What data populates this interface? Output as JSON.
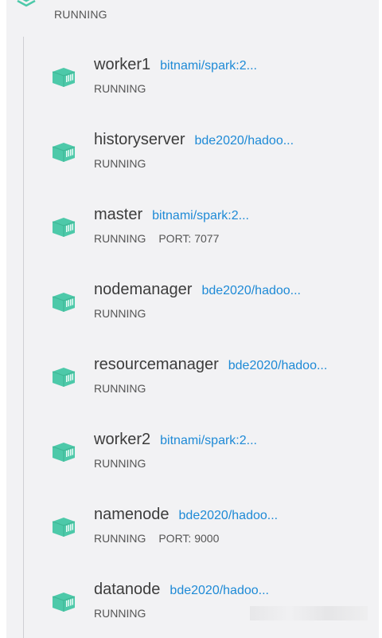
{
  "stack": {
    "status": "RUNNING",
    "icon": "layers-icon"
  },
  "colors": {
    "container_icon": "#4dc9a9",
    "image_link": "#1e8ad6",
    "background": "#f2f2f4"
  },
  "containers": [
    {
      "name": "worker1",
      "image": "bitnami/spark:2...",
      "status": "RUNNING",
      "port": ""
    },
    {
      "name": "historyserver",
      "image": "bde2020/hadoo...",
      "status": "RUNNING",
      "port": ""
    },
    {
      "name": "master",
      "image": "bitnami/spark:2...",
      "status": "RUNNING",
      "port": "PORT: 7077"
    },
    {
      "name": "nodemanager",
      "image": "bde2020/hadoo...",
      "status": "RUNNING",
      "port": ""
    },
    {
      "name": "resourcemanager",
      "image": "bde2020/hadoo...",
      "status": "RUNNING",
      "port": ""
    },
    {
      "name": "worker2",
      "image": "bitnami/spark:2...",
      "status": "RUNNING",
      "port": ""
    },
    {
      "name": "namenode",
      "image": "bde2020/hadoo...",
      "status": "RUNNING",
      "port": "PORT: 9000"
    },
    {
      "name": "datanode",
      "image": "bde2020/hadoo...",
      "status": "RUNNING",
      "port": ""
    }
  ]
}
